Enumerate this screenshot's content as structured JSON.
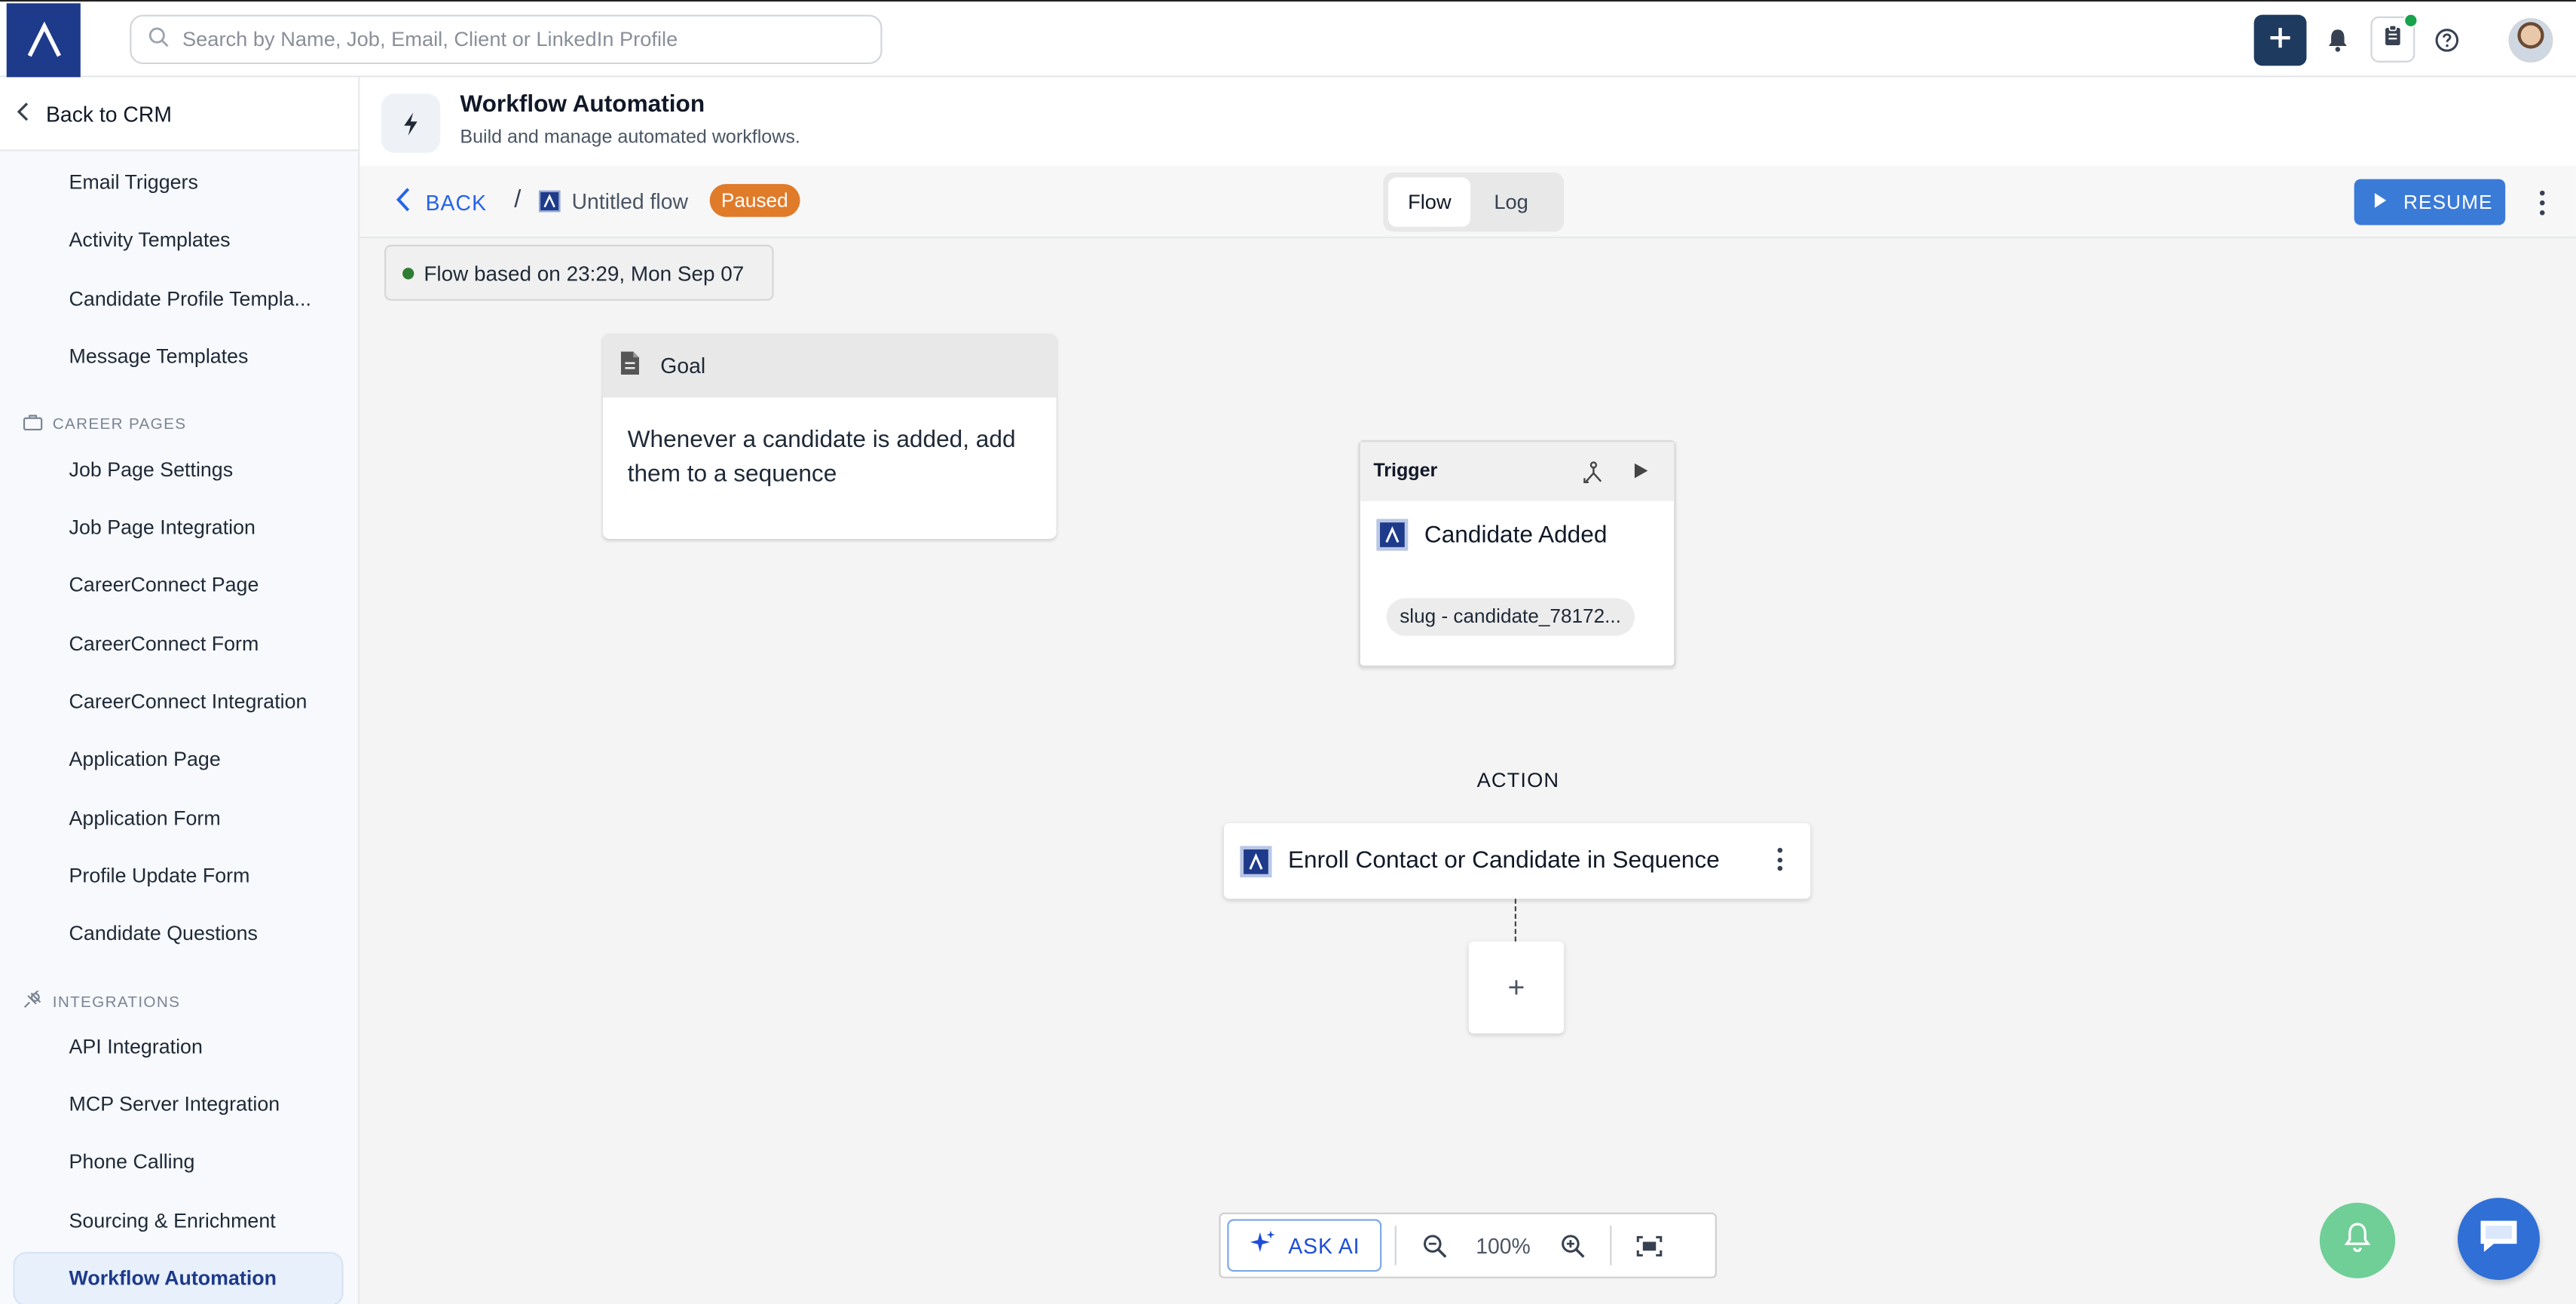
{
  "topbar": {
    "search_placeholder": "Search by Name, Job, Email, Client or LinkedIn Profile"
  },
  "sidebar": {
    "back_label": "Back to CRM",
    "items_top": [
      "Email Triggers",
      "Activity Templates",
      "Candidate Profile Templa...",
      "Message Templates"
    ],
    "section_career": "CAREER PAGES",
    "items_career": [
      "Job Page Settings",
      "Job Page Integration",
      "CareerConnect Page",
      "CareerConnect Form",
      "CareerConnect Integration",
      "Application Page",
      "Application Form",
      "Profile Update Form",
      "Candidate Questions"
    ],
    "section_integrations": "INTEGRATIONS",
    "items_integrations": [
      "API Integration",
      "MCP Server Integration",
      "Phone Calling",
      "Sourcing & Enrichment"
    ],
    "active_item": "Workflow Automation"
  },
  "header": {
    "title": "Workflow Automation",
    "subtitle": "Build and manage automated workflows."
  },
  "flowbar": {
    "back_label": "BACK",
    "separator": "/",
    "flow_name": "Untitled flow",
    "status_badge": "Paused",
    "tabs": [
      "Flow",
      "Log"
    ],
    "active_tab": "Flow",
    "resume_label": "RESUME"
  },
  "canvas": {
    "based_on": "Flow based on 23:29, Mon Sep 07",
    "goal_title": "Goal",
    "goal_text": "Whenever a candidate is added, add them to a sequence",
    "trigger_title": "Trigger",
    "trigger_event": "Candidate Added",
    "trigger_slug": "slug - candidate_78172...",
    "action_heading": "ACTION",
    "action_name": "Enroll Contact or Candidate in Sequence",
    "add_step": "+"
  },
  "zoombar": {
    "ask_ai_label": "ASK AI",
    "zoom_level": "100%"
  },
  "colors": {
    "brand_navy": "#1e3a8a",
    "accent_blue": "#3b7bd8",
    "paused_orange": "#e07b2a",
    "status_green": "#2e7d32"
  },
  "icons": [
    "logo-icon",
    "search-icon",
    "plus-icon",
    "bell-icon",
    "clipboard-icon",
    "help-icon",
    "chevron-left-icon",
    "lightning-icon",
    "document-icon",
    "fork-icon",
    "play-icon",
    "sparkle-icon",
    "zoom-out-icon",
    "zoom-in-icon",
    "fit-screen-icon",
    "chat-icon",
    "briefcase-icon",
    "plug-icon"
  ]
}
